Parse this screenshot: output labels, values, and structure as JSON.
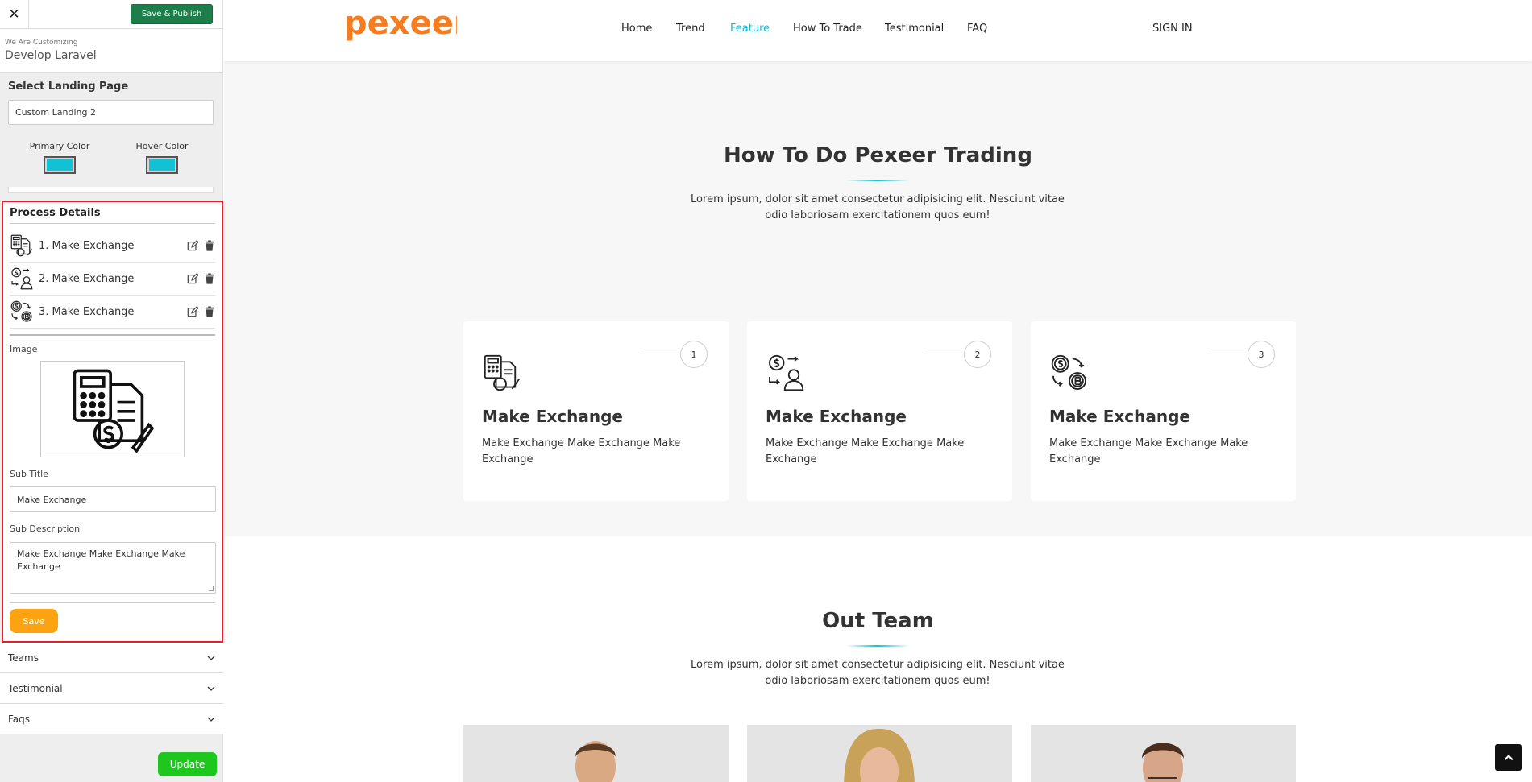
{
  "sidebar": {
    "close_icon": "close-icon",
    "publish_label": "Save & Publish",
    "customizing_label": "We Are Customizing",
    "site_name": "Develop Laravel",
    "landing_title": "Select Landing Page",
    "landing_value": "Custom Landing 2",
    "primary_color_label": "Primary Color",
    "hover_color_label": "Hover Color",
    "primary_color": "#12c1d6",
    "hover_color": "#12c1d6",
    "process": {
      "title": "Process Details",
      "items": [
        {
          "label": "1. Make Exchange",
          "icon": "calculator-document-icon"
        },
        {
          "label": "2. Make Exchange",
          "icon": "dollar-user-exchange-icon"
        },
        {
          "label": "3. Make Exchange",
          "icon": "dollar-bitcoin-exchange-icon"
        }
      ],
      "image_label": "Image",
      "sub_title_label": "Sub Title",
      "sub_title_value": "Make Exchange",
      "sub_desc_label": "Sub Description",
      "sub_desc_value": "Make Exchange Make Exchange Make Exchange",
      "save_label": "Save"
    },
    "accordions": [
      "Teams",
      "Testimonial",
      "Faqs"
    ],
    "update_label": "Update"
  },
  "preview": {
    "logo_text": "pexeer",
    "nav": [
      "Home",
      "Trend",
      "Feature",
      "How To Trade",
      "Testimonial",
      "FAQ"
    ],
    "active_nav": "Feature",
    "sign_in": "SIGN IN",
    "how_to": {
      "title": "How To Do Pexeer Trading",
      "desc": "Lorem ipsum, dolor sit amet consectetur adipisicing elit. Nesciunt vitae odio laboriosam exercitationem quos eum!",
      "cards": [
        {
          "num": "1",
          "title": "Make Exchange",
          "desc": "Make Exchange Make Exchange Make Exchange"
        },
        {
          "num": "2",
          "title": "Make Exchange",
          "desc": "Make Exchange Make Exchange Make Exchange"
        },
        {
          "num": "3",
          "title": "Make Exchange",
          "desc": "Make Exchange Make Exchange Make Exchange"
        }
      ]
    },
    "team": {
      "title": "Out Team",
      "desc": "Lorem ipsum, dolor sit amet consectetur adipisicing elit. Nesciunt vitae odio laboriosam exercitationem quos eum!"
    },
    "accent_color": "#12b6cf",
    "brand_color": "#f57c1f"
  }
}
